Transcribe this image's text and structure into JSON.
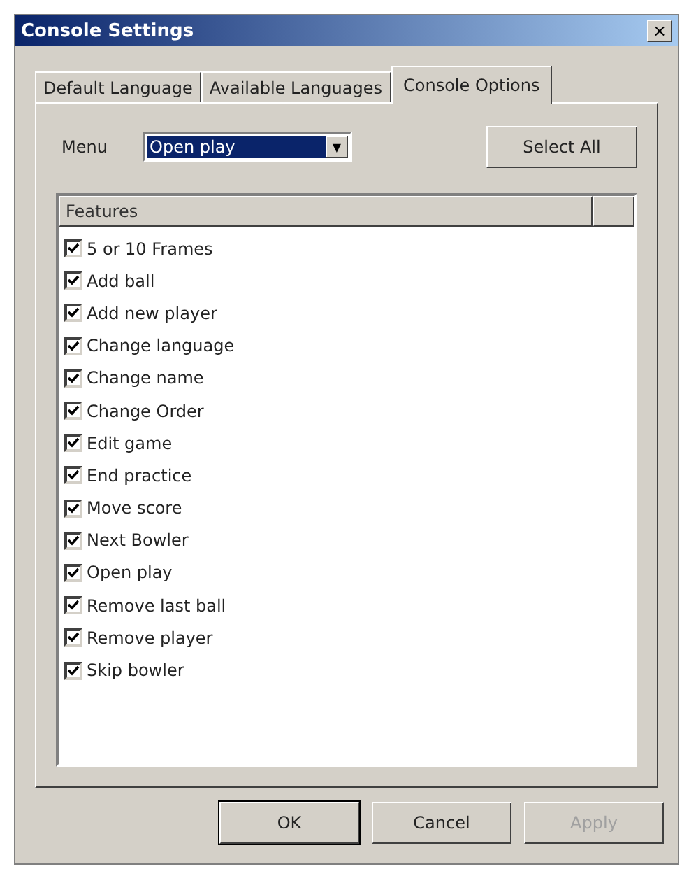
{
  "window": {
    "title": "Console Settings",
    "close": "×"
  },
  "tabs": [
    {
      "label": "Default Language",
      "selected": false
    },
    {
      "label": "Available Languages",
      "selected": false
    },
    {
      "label": "Console Options",
      "selected": true
    }
  ],
  "menu": {
    "label": "Menu",
    "value": "Open play",
    "arrow": "▼"
  },
  "select_all": "Select All",
  "features": {
    "column": "Features",
    "items": [
      {
        "label": "5 or 10 Frames",
        "checked": true
      },
      {
        "label": "Add ball",
        "checked": true
      },
      {
        "label": "Add new player",
        "checked": true
      },
      {
        "label": "Change language",
        "checked": true
      },
      {
        "label": "Change name",
        "checked": true
      },
      {
        "label": "Change Order",
        "checked": true
      },
      {
        "label": "Edit game",
        "checked": true
      },
      {
        "label": "End practice",
        "checked": true
      },
      {
        "label": "Move score",
        "checked": true
      },
      {
        "label": "Next Bowler",
        "checked": true
      },
      {
        "label": "Open play",
        "checked": true
      },
      {
        "label": "Remove last ball",
        "checked": true
      },
      {
        "label": "Remove player",
        "checked": true
      },
      {
        "label": "Skip bowler",
        "checked": true
      }
    ]
  },
  "buttons": [
    {
      "label": "OK",
      "disabled": false,
      "default": true
    },
    {
      "label": "Cancel",
      "disabled": false,
      "default": false
    },
    {
      "label": "Apply",
      "disabled": true,
      "default": false
    }
  ]
}
